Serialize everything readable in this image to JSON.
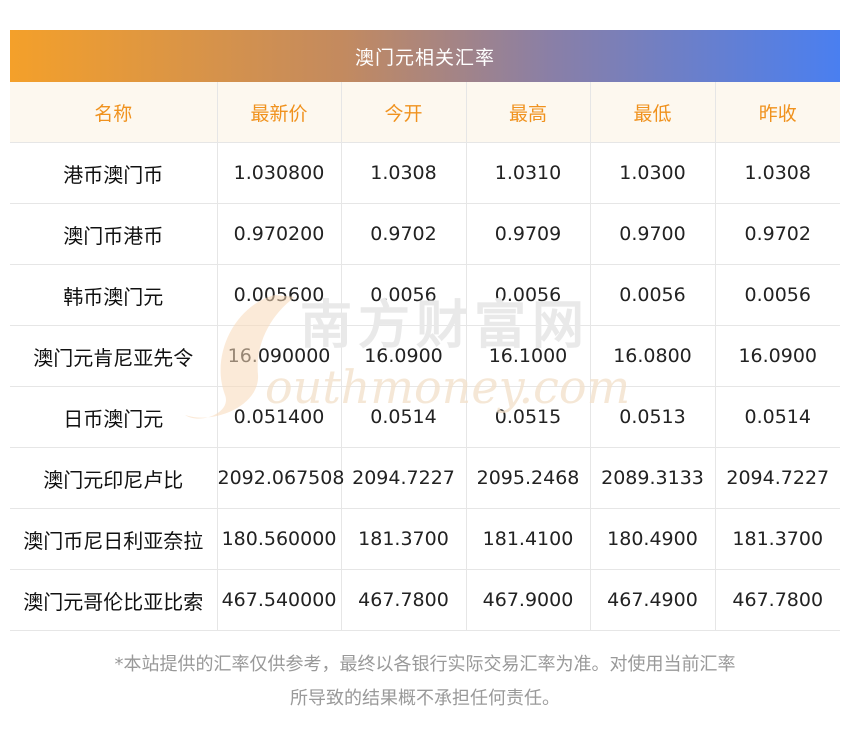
{
  "title": "澳门元相关汇率",
  "columns": [
    "名称",
    "最新价",
    "今开",
    "最高",
    "最低",
    "昨收"
  ],
  "rows": [
    [
      "港币澳门币",
      "1.030800",
      "1.0308",
      "1.0310",
      "1.0300",
      "1.0308"
    ],
    [
      "澳门币港币",
      "0.970200",
      "0.9702",
      "0.9709",
      "0.9700",
      "0.9702"
    ],
    [
      "韩币澳门元",
      "0.005600",
      "0.0056",
      "0.0056",
      "0.0056",
      "0.0056"
    ],
    [
      "澳门元肯尼亚先令",
      "16.090000",
      "16.0900",
      "16.1000",
      "16.0800",
      "16.0900"
    ],
    [
      "日币澳门元",
      "0.051400",
      "0.0514",
      "0.0515",
      "0.0513",
      "0.0514"
    ],
    [
      "澳门元印尼卢比",
      "2092.067508",
      "2094.7227",
      "2095.2468",
      "2089.3133",
      "2094.7227"
    ],
    [
      "澳门币尼日利亚奈拉",
      "180.560000",
      "181.3700",
      "181.4100",
      "180.4900",
      "181.3700"
    ],
    [
      "澳门元哥伦比亚比索",
      "467.540000",
      "467.7800",
      "467.9000",
      "467.4900",
      "467.7800"
    ]
  ],
  "watermark": {
    "text_cn": "南方财富网",
    "text_en": "outhmoney.com"
  },
  "footer": {
    "line1": "*本站提供的汇率仅供参考，最终以各银行实际交易汇率为准。对使用当前汇率",
    "line2": "所导致的结果概不承担任何责任。"
  }
}
